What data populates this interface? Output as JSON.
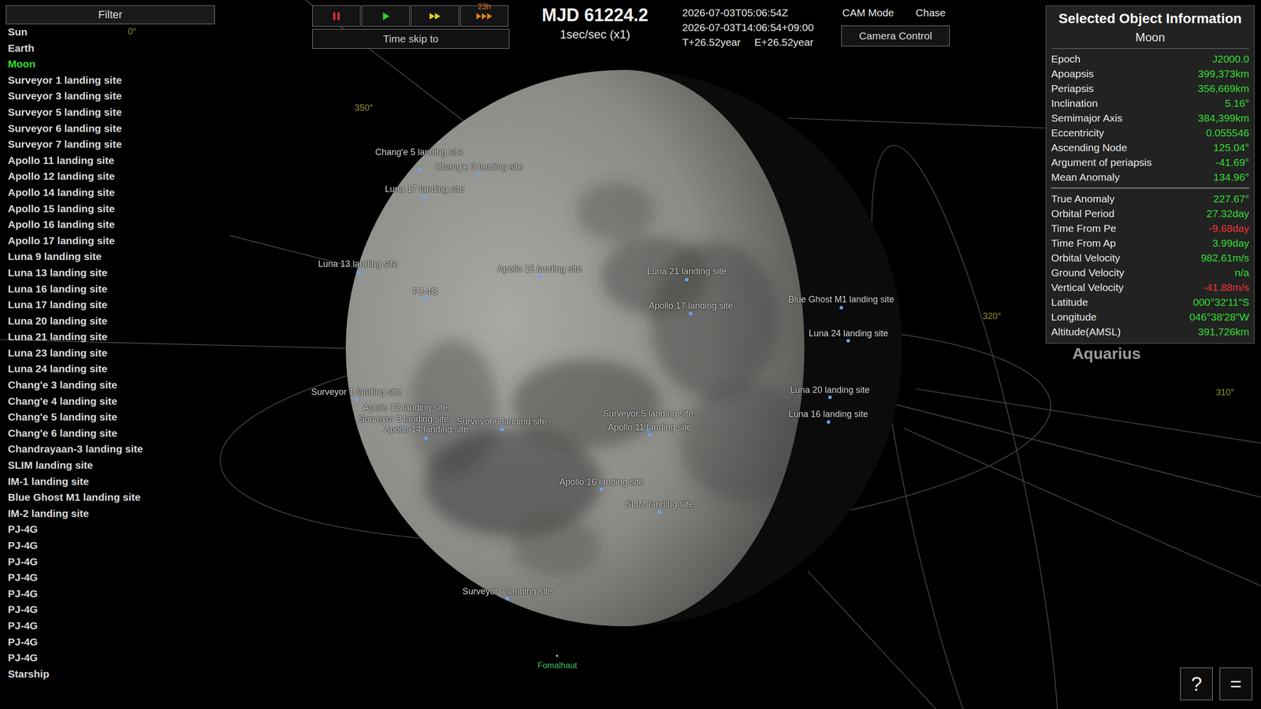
{
  "sidebar": {
    "filter_button": "Filter",
    "items": [
      {
        "label": "Sun",
        "selected": false
      },
      {
        "label": "Earth",
        "selected": false
      },
      {
        "label": "Moon",
        "selected": true
      },
      {
        "label": "Surveyor 1 landing site",
        "selected": false
      },
      {
        "label": "Surveyor 3 landing site",
        "selected": false
      },
      {
        "label": "Surveyor 5 landing site",
        "selected": false
      },
      {
        "label": "Surveyor 6 landing site",
        "selected": false
      },
      {
        "label": "Surveyor 7 landing site",
        "selected": false
      },
      {
        "label": "Apollo 11 landing site",
        "selected": false
      },
      {
        "label": "Apollo 12 landing site",
        "selected": false
      },
      {
        "label": "Apollo 14 landing site",
        "selected": false
      },
      {
        "label": "Apollo 15 landing site",
        "selected": false
      },
      {
        "label": "Apollo 16 landing site",
        "selected": false
      },
      {
        "label": "Apollo 17 landing site",
        "selected": false
      },
      {
        "label": "Luna 9 landing site",
        "selected": false
      },
      {
        "label": "Luna 13 landing site",
        "selected": false
      },
      {
        "label": "Luna 16 landing site",
        "selected": false
      },
      {
        "label": "Luna 17 landing site",
        "selected": false
      },
      {
        "label": "Luna 20 landing site",
        "selected": false
      },
      {
        "label": "Luna 21 landing site",
        "selected": false
      },
      {
        "label": "Luna 23 landing site",
        "selected": false
      },
      {
        "label": "Luna 24 landing site",
        "selected": false
      },
      {
        "label": "Chang'e 3 landing site",
        "selected": false
      },
      {
        "label": "Chang'e 4 landing site",
        "selected": false
      },
      {
        "label": "Chang'e 5 landing site",
        "selected": false
      },
      {
        "label": "Chang'e 6 landing site",
        "selected": false
      },
      {
        "label": "Chandrayaan-3 landing site",
        "selected": false
      },
      {
        "label": "SLIM landing site",
        "selected": false
      },
      {
        "label": "IM-1 landing site",
        "selected": false
      },
      {
        "label": "Blue Ghost M1 landing site",
        "selected": false
      },
      {
        "label": "IM-2 landing site",
        "selected": false
      },
      {
        "label": "PJ-4G",
        "selected": false
      },
      {
        "label": "PJ-4G",
        "selected": false
      },
      {
        "label": "PJ-4G",
        "selected": false
      },
      {
        "label": "PJ-4G",
        "selected": false
      },
      {
        "label": "PJ-4G",
        "selected": false
      },
      {
        "label": "PJ-4G",
        "selected": false
      },
      {
        "label": "PJ-4G",
        "selected": false
      },
      {
        "label": "PJ-4G",
        "selected": false
      },
      {
        "label": "PJ-4G",
        "selected": false
      },
      {
        "label": "Starship",
        "selected": false
      }
    ]
  },
  "time_controls": {
    "buttons": [
      {
        "kind": "pause"
      },
      {
        "kind": "play"
      },
      {
        "kind": "fast"
      },
      {
        "kind": "faster"
      }
    ],
    "badge": "23h",
    "time_skip_button": "Time skip to"
  },
  "clock": {
    "mjd": "MJD 61224.2",
    "rate": "1sec/sec (x1)",
    "utc": "2026-07-03T05:06:54Z",
    "local": "2026-07-03T14:06:54+09:00",
    "elapsed_t": "T+26.52year",
    "elapsed_e": "E+26.52year"
  },
  "camera": {
    "mode_label": "CAM Mode",
    "mode_value": "Chase",
    "control_button": "Camera Control"
  },
  "info_panel": {
    "title": "Selected Object Information",
    "object": "Moon",
    "orbit_rows": [
      {
        "label": "Epoch",
        "value": "J2000.0",
        "color": "#33dd33"
      },
      {
        "label": "Apoapsis",
        "value": "399,373km",
        "color": "#33dd33"
      },
      {
        "label": "Periapsis",
        "value": "356,669km",
        "color": "#33dd33"
      },
      {
        "label": "Inclination",
        "value": "5.16°",
        "color": "#33dd33"
      },
      {
        "label": "Semimajor Axis",
        "value": "384,399km",
        "color": "#33dd33"
      },
      {
        "label": "Eccentricity",
        "value": "0.055546",
        "color": "#33dd33"
      },
      {
        "label": "Ascending Node",
        "value": "125.04°",
        "color": "#33dd33"
      },
      {
        "label": "Argument of periapsis",
        "value": "-41.69°",
        "color": "#33dd33"
      },
      {
        "label": "Mean Anomaly",
        "value": "134.96°",
        "color": "#33dd33"
      }
    ],
    "state_rows": [
      {
        "label": "True Anomaly",
        "value": "227.67°",
        "color": "#33dd33"
      },
      {
        "label": "Orbital Period",
        "value": "27.32day",
        "color": "#33dd33"
      },
      {
        "label": "Time From Pe",
        "value": "-9.68day",
        "color": "#ee3333"
      },
      {
        "label": "Time From Ap",
        "value": "3.99day",
        "color": "#33dd33"
      },
      {
        "label": "Orbital Velocity",
        "value": "982.61m/s",
        "color": "#33dd33"
      },
      {
        "label": "Ground Velocity",
        "value": "n/a",
        "color": "#33dd33"
      },
      {
        "label": "Vertical Velocity",
        "value": "-41.88m/s",
        "color": "#ee3333"
      },
      {
        "label": "Latitude",
        "value": "000°32′11″S",
        "color": "#33dd33"
      },
      {
        "label": "Longitude",
        "value": "046°38′28″W",
        "color": "#33dd33"
      },
      {
        "label": "Altitude(AMSL)",
        "value": "391,726km",
        "color": "#33dd33"
      }
    ]
  },
  "scene": {
    "landing_sites": [
      {
        "label": "Chang'e 5 landing site"
      },
      {
        "label": "Chang'e 3 landing site"
      },
      {
        "label": "Luna 17 landing site"
      },
      {
        "label": "Luna 13 landing site"
      },
      {
        "label": "PJ-4G"
      },
      {
        "label": "Apollo 15 landing site"
      },
      {
        "label": "Luna 21 landing site"
      },
      {
        "label": "Apollo 17 landing site"
      },
      {
        "label": "Blue Ghost M1 landing site"
      },
      {
        "label": "Luna 24 landing site"
      },
      {
        "label": "Surveyor 1 landing site"
      },
      {
        "label": "Surveyor 3 landing site"
      },
      {
        "label": "Apollo 12 landing site"
      },
      {
        "label": "Surveyor 6 landing site"
      },
      {
        "label": "Apollo 14 landing site"
      },
      {
        "label": "Surveyor 5 landing site"
      },
      {
        "label": "Apollo 11 landing site"
      },
      {
        "label": "Luna 20 landing site"
      },
      {
        "label": "Luna 16 landing site"
      },
      {
        "label": "Apollo 16 landing site"
      },
      {
        "label": "SLIM landing site"
      },
      {
        "label": "Surveyor 7 landing site"
      }
    ],
    "degree_marks": [
      "0°",
      "350°",
      "320°",
      "310°"
    ],
    "constellation": "Aquarius",
    "star": "Fomalhaut"
  },
  "corner_buttons": [
    "?",
    "="
  ]
}
